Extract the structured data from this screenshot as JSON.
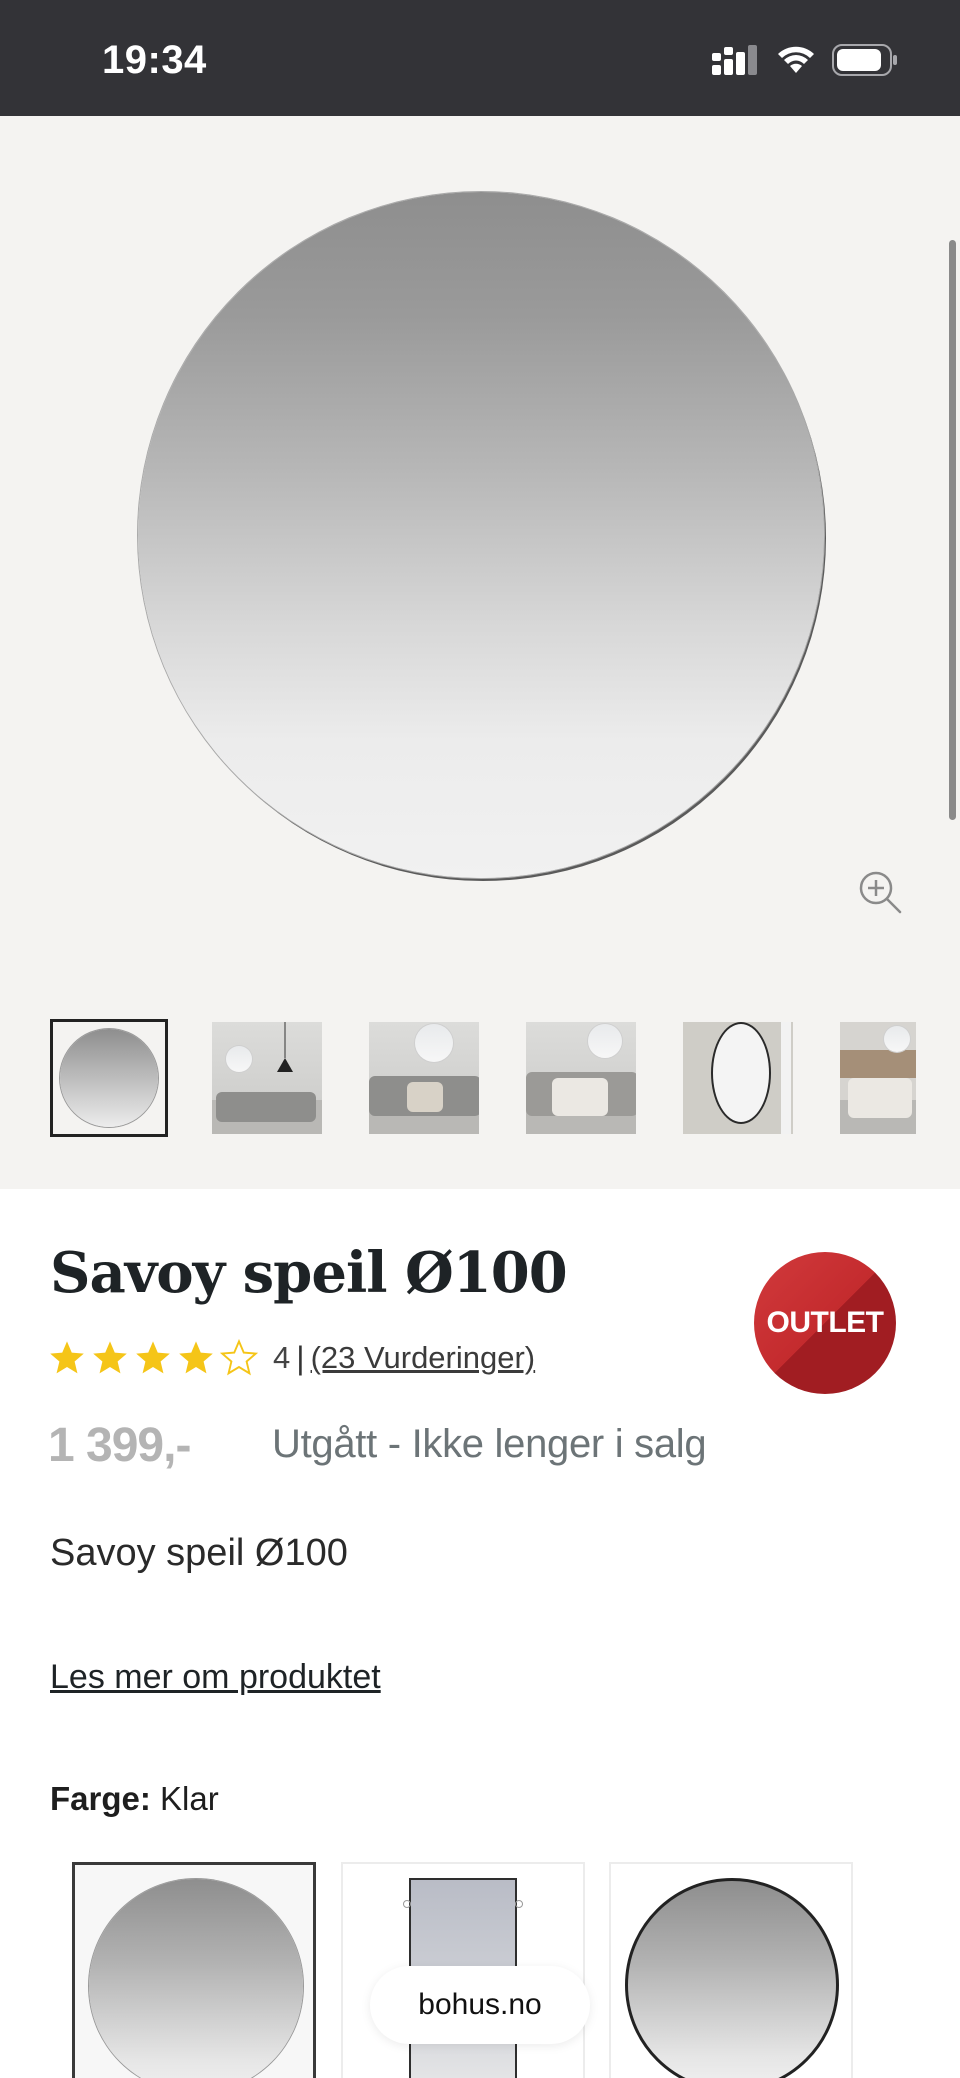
{
  "status_bar": {
    "time": "19:34",
    "icons": [
      "signal-icon",
      "wifi-icon",
      "battery-icon"
    ]
  },
  "gallery": {
    "main_image": "round-mirror",
    "zoom_icon": "zoom-in-icon",
    "thumbnails": [
      {
        "name": "mirror-product"
      },
      {
        "name": "living-room-sofa"
      },
      {
        "name": "living-room-sofa-throw"
      },
      {
        "name": "bedroom"
      },
      {
        "name": "mirror-wall-detail"
      },
      {
        "name": "bedroom-headboard"
      }
    ]
  },
  "product": {
    "title": "Savoy speil Ø100",
    "badge": "OUTLET",
    "rating": {
      "stars": 4,
      "max": 5,
      "score": "4",
      "separator": "|",
      "reviews_link": "(23 Vurderinger)"
    },
    "price": "1 399,-",
    "availability": "Utgått - Ikke lenger i salg",
    "short_description": "Savoy speil Ø100",
    "read_more": "Les mer om produktet",
    "color": {
      "label": "Farge:",
      "value": "Klar"
    }
  },
  "variants": [
    {
      "name": "clear-round",
      "selected": true
    },
    {
      "name": "rectangular",
      "selected": false
    },
    {
      "name": "black-frame-round",
      "selected": false
    }
  ],
  "browser": {
    "domain": "bohus.no"
  },
  "colors": {
    "status_bar": "#333337",
    "gallery_bg": "#f4f3f1",
    "badge_red": "#c42b2e",
    "star_yellow": "#f5c518",
    "price_grey": "#b4b4b4",
    "availability_grey": "#6c7477"
  }
}
